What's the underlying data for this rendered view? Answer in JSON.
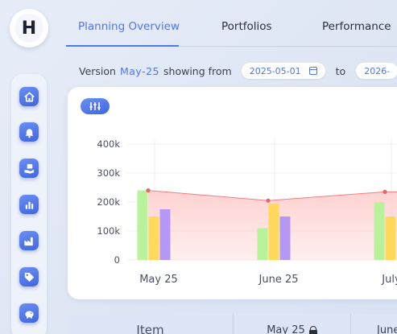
{
  "logo": {
    "letter": "H"
  },
  "tabs": [
    {
      "label": "Planning Overview",
      "active": true
    },
    {
      "label": "Portfolios",
      "active": false
    },
    {
      "label": "Performance",
      "active": false
    }
  ],
  "sidebar": {
    "items": [
      {
        "icon": "home-icon"
      },
      {
        "icon": "bell-icon"
      },
      {
        "icon": "hand-box-icon"
      },
      {
        "icon": "bar-chart-icon"
      },
      {
        "icon": "factory-icon"
      },
      {
        "icon": "tag-icon"
      },
      {
        "icon": "piggy-bank-icon"
      }
    ]
  },
  "version_bar": {
    "prefix": "Version",
    "version": "May-25",
    "middle": "showing from",
    "from_date": "2025-05-01",
    "to_label": "to",
    "to_date": "2026-"
  },
  "colors": {
    "accent": "#4f77e6",
    "green": "#b9f29a",
    "yellow": "#ffd95c",
    "purple": "#b597f5",
    "area_line": "#f07f7f",
    "area_fill": "#ffd0d0"
  },
  "chart_data": {
    "type": "bar",
    "categories": [
      "May 25",
      "June 25",
      "July"
    ],
    "series": [
      {
        "values": [
          240000,
          110000,
          200000
        ]
      },
      {
        "values": [
          150000,
          195000,
          150000
        ]
      },
      {
        "values": [
          175000,
          150000,
          null
        ]
      }
    ],
    "line_series": {
      "type": "area",
      "values": [
        240000,
        205000,
        235000
      ]
    },
    "yticks": [
      "400k",
      "300k",
      "200k",
      "100k",
      "0"
    ],
    "ylim": [
      0,
      400000
    ],
    "grid": true
  },
  "table": {
    "columns": [
      "Item",
      "May 25",
      "June"
    ]
  }
}
